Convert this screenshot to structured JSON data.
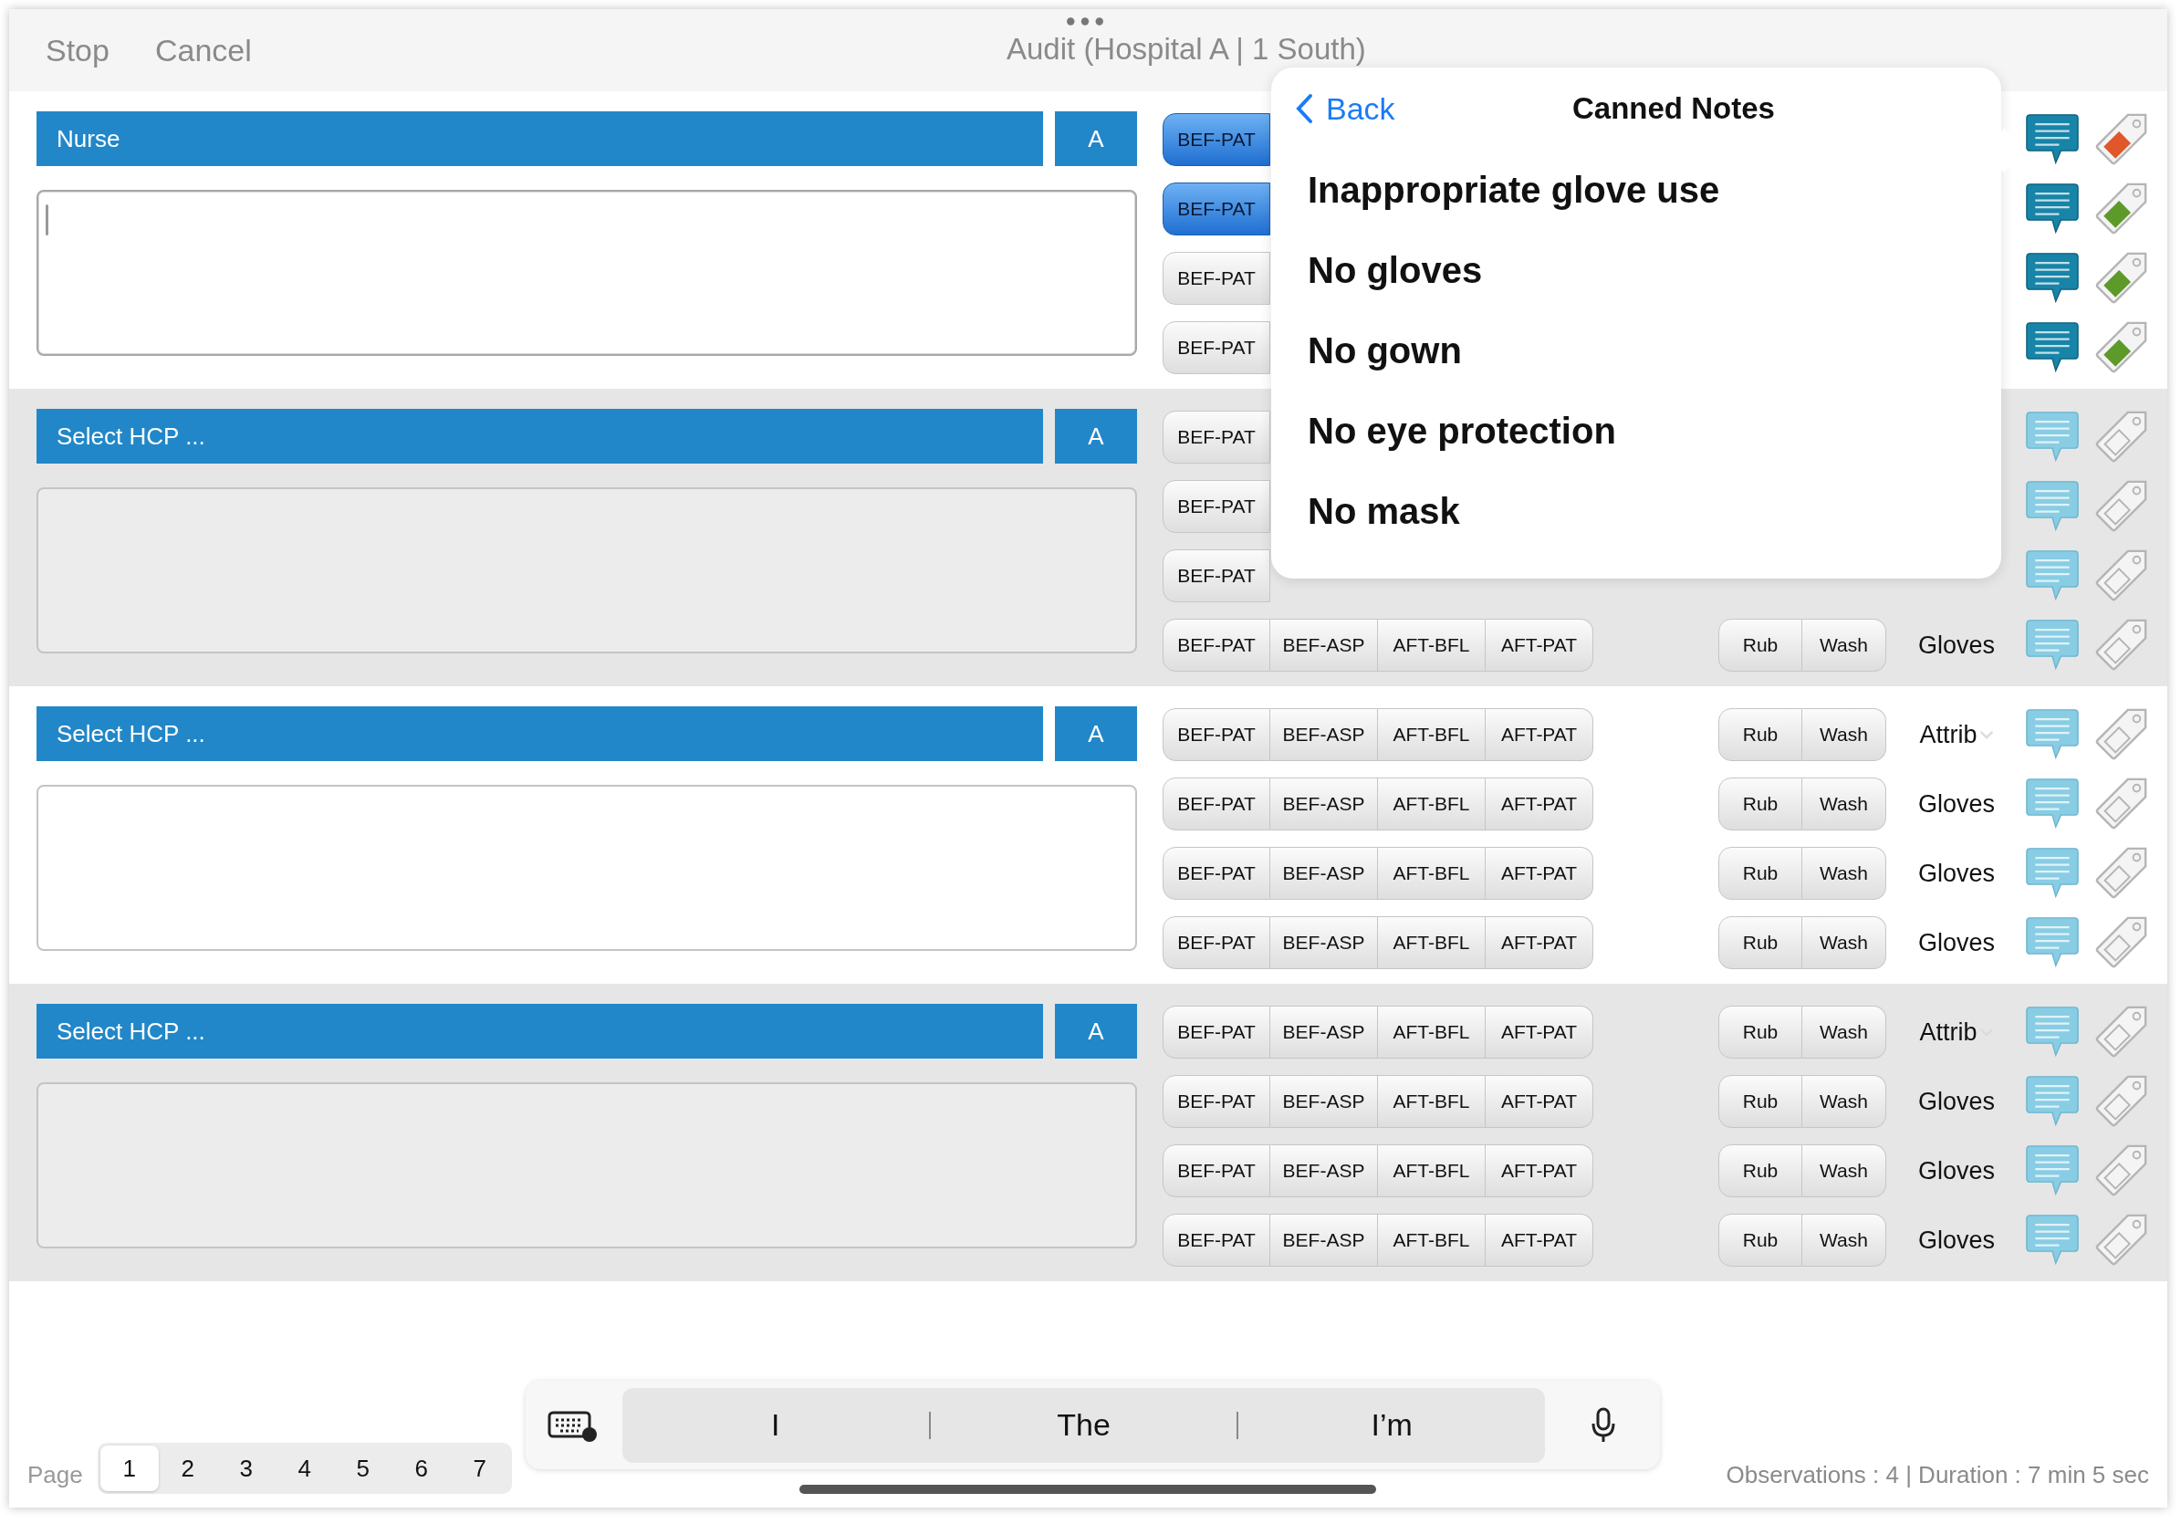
{
  "header": {
    "actions": [
      "Stop",
      "Cancel"
    ],
    "title": "Audit (Hospital A | 1 South)"
  },
  "groups": [
    {
      "hcp": "Nurse",
      "badge": "A",
      "shaded": false,
      "focused": true,
      "rows": [
        {
          "segments": [
            {
              "label": "BEF-PAT",
              "selected": true
            }
          ],
          "note": true,
          "tag": {
            "filled": true,
            "color": "#e0582a"
          }
        },
        {
          "segments": [
            {
              "label": "BEF-PAT",
              "selected": true
            }
          ],
          "note": true,
          "tag": {
            "filled": true,
            "color": "#5e9a2a"
          }
        },
        {
          "segments": [
            {
              "label": "BEF-PAT",
              "selected": false
            }
          ],
          "note": true,
          "tag": {
            "filled": true,
            "color": "#5e9a2a"
          }
        },
        {
          "segments": [
            {
              "label": "BEF-PAT",
              "selected": false
            }
          ],
          "note": true,
          "tag": {
            "filled": true,
            "color": "#5e9a2a"
          }
        }
      ]
    },
    {
      "hcp": "Select HCP ...",
      "badge": "A",
      "shaded": true,
      "focused": false,
      "rows": [
        {
          "segments": [
            {
              "label": "BEF-PAT",
              "selected": false
            }
          ],
          "note": false,
          "tag": {
            "filled": false
          }
        },
        {
          "segments": [
            {
              "label": "BEF-PAT",
              "selected": false
            }
          ],
          "note": false,
          "tag": {
            "filled": false
          }
        },
        {
          "segments": [
            {
              "label": "BEF-PAT",
              "selected": false
            }
          ],
          "note": false,
          "tag": {
            "filled": false
          }
        },
        {
          "segments": [
            {
              "label": "BEF-PAT",
              "selected": false
            },
            {
              "label": "BEF-ASP",
              "selected": false
            },
            {
              "label": "AFT-BFL",
              "selected": false
            },
            {
              "label": "AFT-PAT",
              "selected": false
            }
          ],
          "hands": [
            {
              "label": "Rub",
              "selected": false
            },
            {
              "label": "Wash",
              "selected": false
            }
          ],
          "label": {
            "text": "Gloves",
            "kind": "plain"
          },
          "note": false,
          "tag": {
            "filled": false
          }
        }
      ]
    },
    {
      "hcp": "Select HCP ...",
      "badge": "A",
      "shaded": false,
      "focused": false,
      "rows": [
        {
          "segments": [
            {
              "label": "BEF-PAT",
              "selected": false
            },
            {
              "label": "BEF-ASP",
              "selected": false
            },
            {
              "label": "AFT-BFL",
              "selected": false
            },
            {
              "label": "AFT-PAT",
              "selected": false
            }
          ],
          "hands": [
            {
              "label": "Rub",
              "selected": false
            },
            {
              "label": "Wash",
              "selected": false
            }
          ],
          "label": {
            "text": "Attrib",
            "kind": "dropdown"
          },
          "note": false,
          "tag": {
            "filled": false
          }
        },
        {
          "segments": [
            {
              "label": "BEF-PAT",
              "selected": false
            },
            {
              "label": "BEF-ASP",
              "selected": false
            },
            {
              "label": "AFT-BFL",
              "selected": false
            },
            {
              "label": "AFT-PAT",
              "selected": false
            }
          ],
          "hands": [
            {
              "label": "Rub",
              "selected": false
            },
            {
              "label": "Wash",
              "selected": false
            }
          ],
          "label": {
            "text": "Gloves",
            "kind": "plain"
          },
          "note": false,
          "tag": {
            "filled": false
          }
        },
        {
          "segments": [
            {
              "label": "BEF-PAT",
              "selected": false
            },
            {
              "label": "BEF-ASP",
              "selected": false
            },
            {
              "label": "AFT-BFL",
              "selected": false
            },
            {
              "label": "AFT-PAT",
              "selected": false
            }
          ],
          "hands": [
            {
              "label": "Rub",
              "selected": false
            },
            {
              "label": "Wash",
              "selected": false
            }
          ],
          "label": {
            "text": "Gloves",
            "kind": "plain"
          },
          "note": false,
          "tag": {
            "filled": false
          }
        },
        {
          "segments": [
            {
              "label": "BEF-PAT",
              "selected": false
            },
            {
              "label": "BEF-ASP",
              "selected": false
            },
            {
              "label": "AFT-BFL",
              "selected": false
            },
            {
              "label": "AFT-PAT",
              "selected": false
            }
          ],
          "hands": [
            {
              "label": "Rub",
              "selected": false
            },
            {
              "label": "Wash",
              "selected": false
            }
          ],
          "label": {
            "text": "Gloves",
            "kind": "plain"
          },
          "note": false,
          "tag": {
            "filled": false
          }
        }
      ]
    },
    {
      "hcp": "Select HCP ...",
      "badge": "A",
      "shaded": true,
      "focused": false,
      "rows": [
        {
          "segments": [
            {
              "label": "BEF-PAT",
              "selected": false
            },
            {
              "label": "BEF-ASP",
              "selected": false
            },
            {
              "label": "AFT-BFL",
              "selected": false
            },
            {
              "label": "AFT-PAT",
              "selected": false
            }
          ],
          "hands": [
            {
              "label": "Rub",
              "selected": false
            },
            {
              "label": "Wash",
              "selected": false
            }
          ],
          "label": {
            "text": "Attrib",
            "kind": "dropdown"
          },
          "note": false,
          "tag": {
            "filled": false
          }
        },
        {
          "segments": [
            {
              "label": "BEF-PAT",
              "selected": false
            },
            {
              "label": "BEF-ASP",
              "selected": false
            },
            {
              "label": "AFT-BFL",
              "selected": false
            },
            {
              "label": "AFT-PAT",
              "selected": false
            }
          ],
          "hands": [
            {
              "label": "Rub",
              "selected": false
            },
            {
              "label": "Wash",
              "selected": false
            }
          ],
          "label": {
            "text": "Gloves",
            "kind": "plain"
          },
          "note": false,
          "tag": {
            "filled": false
          }
        },
        {
          "segments": [
            {
              "label": "BEF-PAT",
              "selected": false
            },
            {
              "label": "BEF-ASP",
              "selected": false
            },
            {
              "label": "AFT-BFL",
              "selected": false
            },
            {
              "label": "AFT-PAT",
              "selected": false
            }
          ],
          "hands": [
            {
              "label": "Rub",
              "selected": false
            },
            {
              "label": "Wash",
              "selected": false
            }
          ],
          "label": {
            "text": "Gloves",
            "kind": "plain"
          },
          "note": false,
          "tag": {
            "filled": false
          }
        },
        {
          "segments": [
            {
              "label": "BEF-PAT",
              "selected": false
            },
            {
              "label": "BEF-ASP",
              "selected": false
            },
            {
              "label": "AFT-BFL",
              "selected": false
            },
            {
              "label": "AFT-PAT",
              "selected": false
            }
          ],
          "hands": [
            {
              "label": "Rub",
              "selected": false
            },
            {
              "label": "Wash",
              "selected": false
            }
          ],
          "label": {
            "text": "Gloves",
            "kind": "plain"
          },
          "note": false,
          "tag": {
            "filled": false
          }
        }
      ]
    }
  ],
  "popover": {
    "back": "Back",
    "title": "Canned Notes",
    "items": [
      "Inappropriate glove use",
      "No gloves",
      "No gown",
      "No eye protection",
      "No mask"
    ]
  },
  "pager": {
    "label": "Page",
    "pages": [
      {
        "label": "1",
        "selected": true
      },
      {
        "label": "2",
        "selected": false
      },
      {
        "label": "3",
        "selected": false
      },
      {
        "label": "4",
        "selected": false
      },
      {
        "label": "5",
        "selected": false
      },
      {
        "label": "6",
        "selected": false
      },
      {
        "label": "7",
        "selected": false
      }
    ]
  },
  "keyboard": {
    "suggestions": [
      "I",
      "The",
      "I’m"
    ]
  },
  "status": "Observations : 4 | Duration : 7 min 5 sec"
}
